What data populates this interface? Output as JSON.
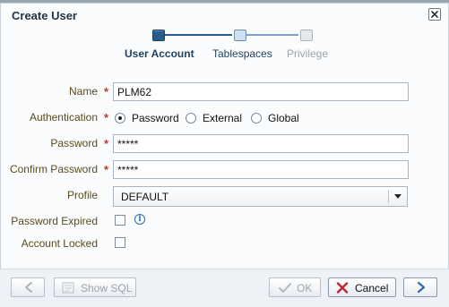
{
  "dialog": {
    "title": "Create User"
  },
  "train": {
    "steps": [
      {
        "label": "User Account"
      },
      {
        "label": "Tablespaces"
      },
      {
        "label": "Privilege"
      }
    ]
  },
  "form": {
    "name": {
      "label": "Name",
      "value": "PLM62",
      "required_mark": "*"
    },
    "authentication": {
      "label": "Authentication",
      "required_mark": "*",
      "options": [
        "Password",
        "External",
        "Global"
      ],
      "selected": "Password"
    },
    "password": {
      "label": "Password",
      "value": "*****",
      "required_mark": "*"
    },
    "confirm_password": {
      "label": "Confirm Password",
      "value": "*****",
      "required_mark": "*"
    },
    "profile": {
      "label": "Profile",
      "value": "DEFAULT"
    },
    "password_expired": {
      "label": "Password Expired",
      "checked": false
    },
    "account_locked": {
      "label": "Account Locked",
      "checked": false
    }
  },
  "footer": {
    "show_sql_label": "Show SQL",
    "ok_label": "OK",
    "cancel_label": "Cancel"
  },
  "colors": {
    "accent": "#2b5d8c",
    "required": "#c0392b",
    "label": "#5a4a1c",
    "cancel_icon": "#c0262d",
    "next_icon": "#2f6db0"
  }
}
